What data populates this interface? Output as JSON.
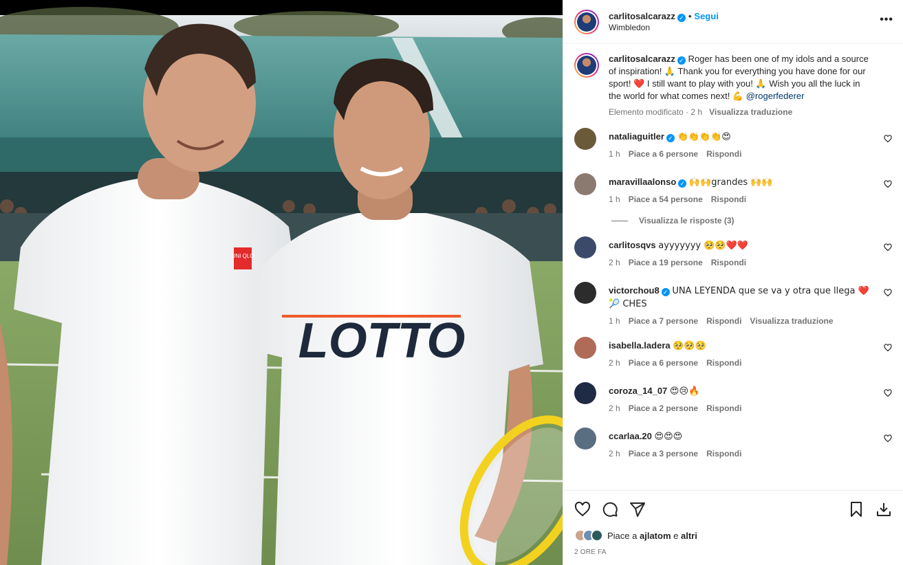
{
  "post": {
    "username": "carlitosalcarazz",
    "follow_label": "Segui",
    "location": "Wimbledon",
    "more_label": "•••",
    "photo": {
      "shirt_left_logo": "UNI QLO",
      "shirt_right_logo": "LOTTO"
    }
  },
  "caption": {
    "username": "carlitosalcarazz",
    "text": "Roger has been one of my idols and a source of inspiration! 🙏 Thank you for everything you have done for our sport! ❤️ I still want to play with you! 🙏 Wish you all the luck in the world for what comes next! 💪",
    "mention": "@rogerfederer",
    "edited_label": "Elemento modificato",
    "time": "2 h",
    "translate_label": "Visualizza traduzione"
  },
  "comments": [
    {
      "user": "nataliaguitler",
      "verified": true,
      "text": "👏👏👏👏😍",
      "time": "1 h",
      "likes": "Piace a 6 persone",
      "reply": "Rispondi",
      "avatar_color": "#6a5a3a"
    },
    {
      "user": "maravillaalonso",
      "verified": true,
      "text": "🙌🙌grandes 🙌🙌",
      "time": "1 h",
      "likes": "Piace a 54 persone",
      "reply": "Rispondi",
      "avatar_color": "#8a7a70",
      "replies": "Visualizza le risposte (3)"
    },
    {
      "user": "carlitosqvs",
      "verified": false,
      "text": "ayyyyyyy 🥺🥺❤️❤️",
      "time": "2 h",
      "likes": "Piace a 19 persone",
      "reply": "Rispondi",
      "avatar_color": "#3b4a6b"
    },
    {
      "user": "victorchou8",
      "verified": true,
      "text": "UNA LEYENDA que se va y otra que llega ❤️🎾 CHES",
      "time": "1 h",
      "likes": "Piace a 7 persone",
      "reply": "Rispondi",
      "translate": "Visualizza traduzione",
      "avatar_color": "#2c2c2c"
    },
    {
      "user": "isabella.ladera",
      "verified": false,
      "text": "🥺🥺🥺",
      "time": "2 h",
      "likes": "Piace a 6 persone",
      "reply": "Rispondi",
      "avatar_color": "#b06a58"
    },
    {
      "user": "coroza_14_07",
      "verified": false,
      "text": "😍😢🔥",
      "time": "2 h",
      "likes": "Piace a 2 persone",
      "reply": "Rispondi",
      "avatar_color": "#1f2a44"
    },
    {
      "user": "ccarlaa.20",
      "verified": false,
      "text": "😍😍😍",
      "time": "2 h",
      "likes": "Piace a 3 persone",
      "reply": "Rispondi",
      "avatar_color": "#5a6e82"
    }
  ],
  "likes_bar": {
    "prefix": "Piace a",
    "user": "ajlatom",
    "middle": "e",
    "others": "altri",
    "ago": "2 ORE FA"
  },
  "colors": {
    "accent": "#0095f6",
    "text": "#262626",
    "muted": "#737373",
    "border": "#efefef"
  },
  "icons": [
    "heart-icon",
    "comment-icon",
    "share-icon",
    "bookmark-icon",
    "download-icon"
  ]
}
